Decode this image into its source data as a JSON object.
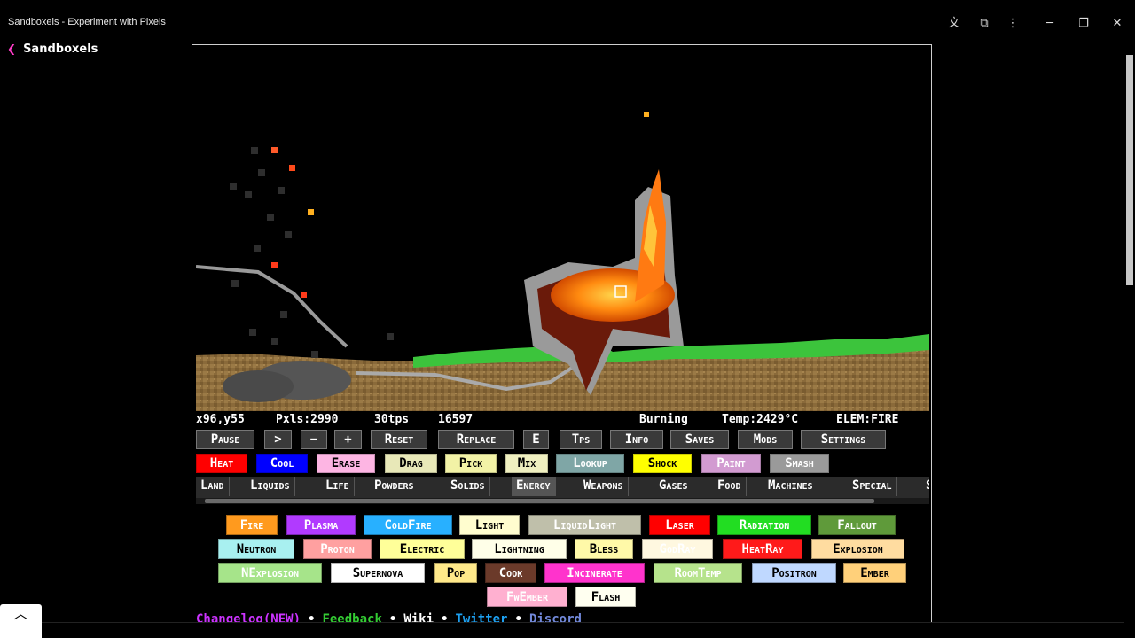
{
  "window": {
    "title": "Sandboxels - Experiment with Pixels",
    "back_label": "Sandboxels",
    "icons": [
      "translate-icon",
      "extensions-icon",
      "more-icon",
      "minimize-icon",
      "restore-icon",
      "close-icon"
    ]
  },
  "stats": {
    "coords": "x96,y55",
    "pixels": "Pxls:2990",
    "tps": "30tps",
    "ticks": "16597",
    "state": "Burning",
    "temp": "Temp:2429°C",
    "element": "ELEM:FIRE"
  },
  "controls": [
    "Pause",
    ">",
    "−",
    "+",
    "Reset",
    "Replace",
    "E",
    "Tps",
    "Info",
    "Saves",
    "Mods",
    "Settings"
  ],
  "tools": [
    {
      "label": "Heat",
      "bg": "#ff0000",
      "fg": "#ffffff"
    },
    {
      "label": "Cool",
      "bg": "#0000ff",
      "fg": "#ffffff"
    },
    {
      "label": "Erase",
      "bg": "#fdb5e3",
      "fg": "#000000"
    },
    {
      "label": "Drag",
      "bg": "#e8e8b8",
      "fg": "#000000"
    },
    {
      "label": "Pick",
      "bg": "#f2f2a6",
      "fg": "#000000"
    },
    {
      "label": "Mix",
      "bg": "#f0f0c0",
      "fg": "#000000"
    },
    {
      "label": "Lookup",
      "bg": "#7fa6a6",
      "fg": "#ffffff"
    },
    {
      "label": "Shock",
      "bg": "#ffff00",
      "fg": "#000000"
    },
    {
      "label": "Paint",
      "bg": "#d29bd1",
      "fg": "#ffffff"
    },
    {
      "label": "Smash",
      "bg": "#9a9a9a",
      "fg": "#ffffff"
    }
  ],
  "categories": [
    "Land",
    "Liquids",
    "Life",
    "Powders",
    "Solids",
    "Energy",
    "Weapons",
    "Gases",
    "Food",
    "Machines",
    "Special",
    "S"
  ],
  "active_category": "Energy",
  "elements": [
    [
      {
        "label": "Fire",
        "bg": "#ff9a1e",
        "fg": "#ffffff"
      },
      {
        "label": "Plasma",
        "bg": "#b13aff",
        "fg": "#ffffff"
      },
      {
        "label": "ColdFire",
        "bg": "#28b0ff",
        "fg": "#ffffff"
      },
      {
        "label": "Light",
        "bg": "#fffdcf",
        "fg": "#000000"
      },
      {
        "label": "LiquidLight",
        "bg": "#bfbfaa",
        "fg": "#ffffff"
      },
      {
        "label": "Laser",
        "bg": "#ff0000",
        "fg": "#ffffff"
      },
      {
        "label": "Radiation",
        "bg": "#22dd22",
        "fg": "#ffffff"
      },
      {
        "label": "Fallout",
        "bg": "#5f9a3a",
        "fg": "#ffffff"
      }
    ],
    [
      {
        "label": "Neutron",
        "bg": "#a8f0f0",
        "fg": "#000000"
      },
      {
        "label": "Proton",
        "bg": "#ffa0a0",
        "fg": "#ffffff"
      },
      {
        "label": "Electric",
        "bg": "#ffff99",
        "fg": "#000000"
      },
      {
        "label": "Lightning",
        "bg": "#ffffe8",
        "fg": "#000000"
      },
      {
        "label": "Bless",
        "bg": "#fff9a8",
        "fg": "#000000"
      },
      {
        "label": "GodRay",
        "bg": "#fff8e0",
        "fg": "#ffffff"
      },
      {
        "label": "HeatRay",
        "bg": "#ff1a1a",
        "fg": "#ffffff"
      },
      {
        "label": "Explosion",
        "bg": "#ffdca0",
        "fg": "#000000"
      }
    ],
    [
      {
        "label": "NExplosion",
        "bg": "#a6e48a",
        "fg": "#ffffff"
      },
      {
        "label": "Supernova",
        "bg": "#ffffff",
        "fg": "#000000"
      },
      {
        "label": "Pop",
        "bg": "#ffe98a",
        "fg": "#000000"
      },
      {
        "label": "Cook",
        "bg": "#6b3a2a",
        "fg": "#ffffff"
      },
      {
        "label": "Incinerate",
        "bg": "#ff33cc",
        "fg": "#ffffff"
      },
      {
        "label": "RoomTemp",
        "bg": "#b6e38c",
        "fg": "#ffffff"
      },
      {
        "label": "Positron",
        "bg": "#bfd8ff",
        "fg": "#000000"
      },
      {
        "label": "Ember",
        "bg": "#ffd07a",
        "fg": "#000000"
      }
    ],
    [
      {
        "label": "FwEmber",
        "bg": "#ffb0d0",
        "fg": "#ffffff"
      },
      {
        "label": "Flash",
        "bg": "#fffff0",
        "fg": "#000000"
      }
    ]
  ],
  "footer": [
    {
      "label": "Changelog(NEW)",
      "color": "#cc33ff"
    },
    {
      "label": "•",
      "color": "#ffffff"
    },
    {
      "label": "Feedback",
      "color": "#33cc33"
    },
    {
      "label": "•",
      "color": "#ffffff"
    },
    {
      "label": "Wiki",
      "color": "#ffffff"
    },
    {
      "label": "•",
      "color": "#ffffff"
    },
    {
      "label": "Twitter",
      "color": "#1da1f2"
    },
    {
      "label": "•",
      "color": "#ffffff"
    },
    {
      "label": "Discord",
      "color": "#7289da"
    }
  ]
}
